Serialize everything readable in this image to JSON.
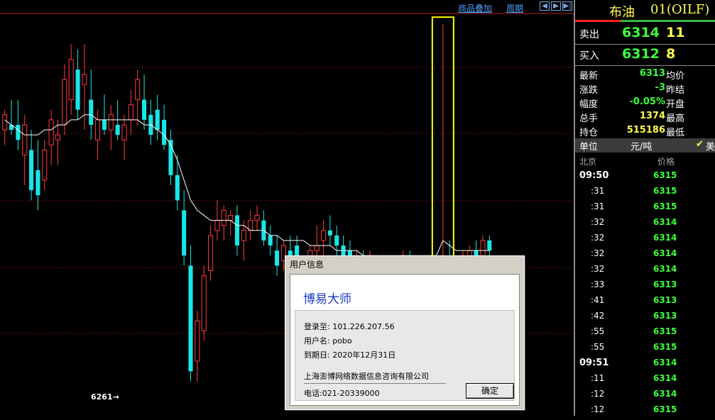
{
  "toolbar": {
    "overlay_link": "商品叠加",
    "period_link": "周期",
    "nav_left_icon": "left-arrow",
    "nav_right_icon": "right-arrow",
    "nav_end_icon": "end-arrow"
  },
  "chart": {
    "low_marker_label": "6261→",
    "colors": {
      "up": "#ff3c3c",
      "down": "#19e6e6",
      "ma": "#ffffff",
      "grid": "#b01e1e",
      "highlight": "#ffff00"
    }
  },
  "chart_data": {
    "type": "candlestick",
    "title": "",
    "xlabel": "",
    "ylabel": "",
    "ylim": [
      6256,
      6335
    ],
    "annotations": [
      "6261→"
    ],
    "candles": [
      [
        6312,
        6316,
        6309,
        6315
      ],
      [
        6313,
        6318,
        6311,
        6312
      ],
      [
        6313,
        6318,
        6308,
        6310
      ],
      [
        6307,
        6315,
        6301,
        6313
      ],
      [
        6308,
        6312,
        6298,
        6300
      ],
      [
        6304,
        6310,
        6296,
        6299
      ],
      [
        6302,
        6310,
        6300,
        6308
      ],
      [
        6309,
        6316,
        6305,
        6314
      ],
      [
        6310,
        6314,
        6305,
        6311
      ],
      [
        6313,
        6325,
        6311,
        6322
      ],
      [
        6318,
        6329,
        6315,
        6326
      ],
      [
        6324,
        6328,
        6314,
        6316
      ],
      [
        6321,
        6329,
        6312,
        6323
      ],
      [
        6318,
        6324,
        6310,
        6313
      ],
      [
        6310,
        6316,
        6306,
        6314
      ],
      [
        6314,
        6319,
        6311,
        6312
      ],
      [
        6312,
        6317,
        6308,
        6315
      ],
      [
        6313,
        6318,
        6310,
        6311
      ],
      [
        6310,
        6315,
        6306,
        6313
      ],
      [
        6314,
        6320,
        6311,
        6317
      ],
      [
        6318,
        6324,
        6313,
        6322
      ],
      [
        6318,
        6323,
        6312,
        6314
      ],
      [
        6315,
        6318,
        6309,
        6311
      ],
      [
        6316,
        6319,
        6310,
        6312
      ],
      [
        6314,
        6317,
        6308,
        6309
      ],
      [
        6310,
        6312,
        6301,
        6303
      ],
      [
        6303,
        6307,
        6296,
        6298
      ],
      [
        6296,
        6300,
        6285,
        6287
      ],
      [
        6285,
        6289,
        6262,
        6264
      ],
      [
        6266,
        6276,
        6262,
        6274
      ],
      [
        6272,
        6285,
        6270,
        6283
      ],
      [
        6284,
        6293,
        6282,
        6291
      ],
      [
        6292,
        6298,
        6290,
        6294
      ],
      [
        6293,
        6297,
        6290,
        6296
      ],
      [
        6294,
        6296,
        6291,
        6295
      ],
      [
        6295,
        6297,
        6287,
        6289
      ],
      [
        6290,
        6294,
        6286,
        6292
      ],
      [
        6292,
        6296,
        6290,
        6294
      ],
      [
        6294,
        6297,
        6292,
        6295
      ],
      [
        6294,
        6296,
        6289,
        6290
      ],
      [
        6291,
        6293,
        6287,
        6289
      ],
      [
        6288,
        6291,
        6283,
        6285
      ],
      [
        6286,
        6290,
        6284,
        6289
      ],
      [
        6288,
        6291,
        6285,
        6287
      ],
      [
        6289,
        6291,
        6285,
        6287
      ],
      [
        6286,
        6287,
        6283,
        6284
      ],
      [
        6284,
        6289,
        6283,
        6288
      ],
      [
        6288,
        6293,
        6286,
        6289
      ],
      [
        6290,
        6294,
        6287,
        6292
      ],
      [
        6292,
        6295,
        6289,
        6291
      ],
      [
        6291,
        6293,
        6287,
        6289
      ],
      [
        6289,
        6291,
        6286,
        6287
      ],
      [
        6288,
        6290,
        6285,
        6286
      ],
      [
        6286,
        6288,
        6284,
        6287
      ],
      [
        6287,
        6288,
        6285,
        6286
      ],
      [
        6286,
        6288,
        6285,
        6287
      ],
      [
        6286,
        6287,
        6284,
        6285
      ],
      [
        6285,
        6287,
        6284,
        6286
      ],
      [
        6286,
        6287,
        6285,
        6286
      ],
      [
        6286,
        6287,
        6284,
        6285
      ],
      [
        6285,
        6288,
        6284,
        6287
      ],
      [
        6287,
        6288,
        6285,
        6286
      ],
      [
        6286,
        6287,
        6285,
        6286
      ],
      [
        6286,
        6287,
        6285,
        6286
      ],
      [
        6286,
        6287,
        6284,
        6285
      ],
      [
        6285,
        6287,
        6284,
        6286
      ],
      [
        6286,
        6333,
        6285,
        6287
      ],
      [
        6287,
        6290,
        6284,
        6285
      ],
      [
        6285,
        6287,
        6284,
        6286
      ],
      [
        6286,
        6288,
        6285,
        6287
      ],
      [
        6287,
        6289,
        6286,
        6288
      ],
      [
        6288,
        6290,
        6286,
        6287
      ],
      [
        6287,
        6291,
        6286,
        6290
      ],
      [
        6290,
        6291,
        6287,
        6288
      ]
    ],
    "ma": [
      6314,
      6313,
      6312,
      6311,
      6311,
      6311,
      6312,
      6312,
      6313,
      6313,
      6314,
      6314,
      6315,
      6315,
      6314,
      6314,
      6314,
      6314,
      6314,
      6314,
      6314,
      6313,
      6313,
      6312,
      6311,
      6309,
      6306,
      6302,
      6298,
      6296,
      6295,
      6294,
      6294,
      6294,
      6294,
      6293,
      6293,
      6292,
      6292,
      6292,
      6291,
      6291,
      6290,
      6290,
      6290,
      6290,
      6289,
      6289,
      6289,
      6289,
      6288,
      6288,
      6288,
      6288,
      6287,
      6287,
      6287,
      6287,
      6287,
      6287,
      6287,
      6287,
      6287,
      6287,
      6287,
      6287,
      6290,
      6289,
      6288,
      6288,
      6288,
      6288,
      6288,
      6288
    ]
  },
  "quote": {
    "name": "布油",
    "code": "01(OILF)",
    "sell_label": "卖出",
    "sell_price": "6314",
    "sell_vol": "11",
    "buy_label": "买入",
    "buy_price": "6312",
    "buy_vol": "8",
    "rows": [
      {
        "k": "最新",
        "v": "6313",
        "k2": "均价",
        "color": "#3cff3c"
      },
      {
        "k": "涨跌",
        "v": "-3",
        "k2": "昨结",
        "color": "#3cff3c"
      },
      {
        "k": "幅度",
        "v": "-0.05%",
        "k2": "开盘",
        "color": "#3cff3c"
      },
      {
        "k": "总手",
        "v": "1374",
        "k2": "最高",
        "color": "#ffff4f"
      },
      {
        "k": "持仓",
        "v": "515186",
        "k2": "最低",
        "color": "#ffff4f"
      }
    ],
    "unit_label": "单位",
    "unit_value": "元/吨",
    "unit_right": "美",
    "ticks_header_left": "北京",
    "ticks_header_right": "价格",
    "ticks": [
      {
        "t": "09:50",
        "p": "6315",
        "main": true
      },
      {
        "t": ":31",
        "p": "6315"
      },
      {
        "t": ":31",
        "p": "6315"
      },
      {
        "t": ":32",
        "p": "6314"
      },
      {
        "t": ":32",
        "p": "6314"
      },
      {
        "t": ":32",
        "p": "6314"
      },
      {
        "t": ":32",
        "p": "6314"
      },
      {
        "t": ":33",
        "p": "6313"
      },
      {
        "t": ":41",
        "p": "6313"
      },
      {
        "t": ":42",
        "p": "6313"
      },
      {
        "t": ":55",
        "p": "6315"
      },
      {
        "t": ":55",
        "p": "6315"
      },
      {
        "t": "09:51",
        "p": "6314",
        "main": true
      },
      {
        "t": ":11",
        "p": "6314"
      },
      {
        "t": ":12",
        "p": "6314"
      },
      {
        "t": ":12",
        "p": "6315"
      }
    ]
  },
  "dialog": {
    "title": "用户信息",
    "brand": "博易大师",
    "login_label": "登录至: 101.226.207.56",
    "user_label": "用户名: pobo",
    "expire_label": "到期日: 2020年12月31日",
    "company": "上海澎博网络数据信息咨询有限公司",
    "phone": "电话:021-20339000",
    "ok_button": "确定"
  }
}
